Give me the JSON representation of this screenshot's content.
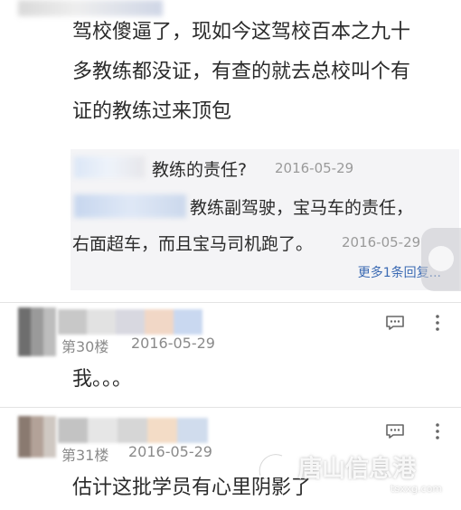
{
  "post": {
    "text_lines": [
      "驾校傻逼了，现如今这驾校百本之九十",
      "多教练都没证，有查的就去总校叫个有",
      "证的教练过来顶包"
    ]
  },
  "replies": [
    {
      "text": "教练的责任?",
      "date": "2016-05-29"
    },
    {
      "text_line1": "教练副驾驶，宝马车的责任，",
      "text_line2": "右面超车，而且宝马司机跑了。",
      "date": "2016-05-29"
    }
  ],
  "more_replies_label": "更多1条回复...",
  "comments": [
    {
      "floor": "第30楼",
      "date": "2016-05-29",
      "text": "我。。。"
    },
    {
      "floor": "第31楼",
      "date": "2016-05-29",
      "text": "估计这批学员有心里阴影了"
    }
  ],
  "watermark": {
    "name": "唐山信息港",
    "url": "tsxxg.com"
  },
  "icons": {
    "comment": "comment-icon",
    "more": "more-vertical-icon"
  }
}
